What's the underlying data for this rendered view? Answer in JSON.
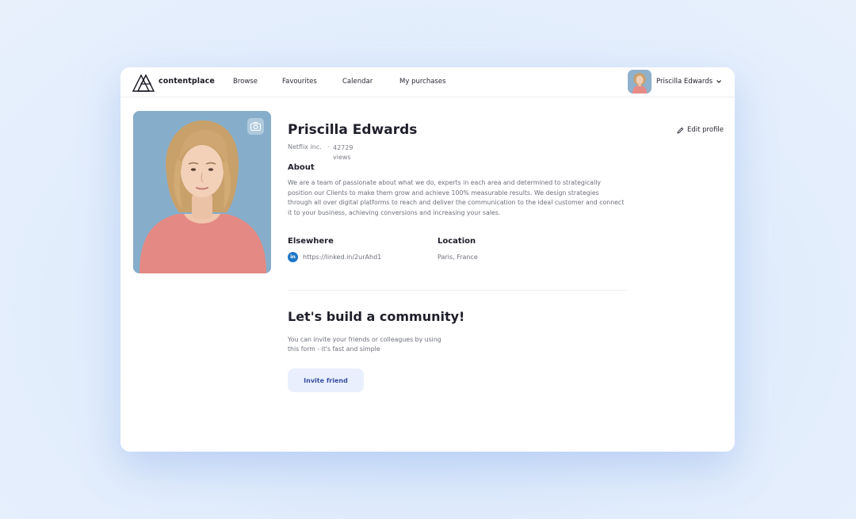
{
  "header": {
    "logo_text": "contentplace",
    "nav": [
      "Browse",
      "Favourites",
      "Calendar",
      "My purchases"
    ],
    "user_name": "Priscilla Edwards"
  },
  "profile": {
    "name": "Priscilla Edwards",
    "edit_label": "Edit profile",
    "company": "Netflix inc.",
    "separator": "·",
    "views_count": "42729",
    "views_label": "views",
    "about_heading": "About",
    "about_text": "We are a team of passionate about what we do, experts in each area and determined to strategically position our Clients to make them grow and achieve 100% measurable results. We design strategies through all over digital platforms to reach and deliver the communication to the ideal customer and connect it to your business, achieving conversions and increasing your sales.",
    "elsewhere_heading": "Elsewhere",
    "linkedin_glyph": "in",
    "linkedin_url": "https://linked.in/2urAhd1",
    "location_heading": "Location",
    "location": "Paris, France"
  },
  "community": {
    "heading": "Let's build a community!",
    "text": "You can invite your friends or colleagues by using this form - it's fast and simple",
    "button_label": "Invite friend"
  },
  "colors": {
    "background": "#dde9fb",
    "accent": "#3b4fa3",
    "button_bg": "#e9effd",
    "linkedin": "#1e77c8",
    "photo_bg": "#86aecb"
  }
}
